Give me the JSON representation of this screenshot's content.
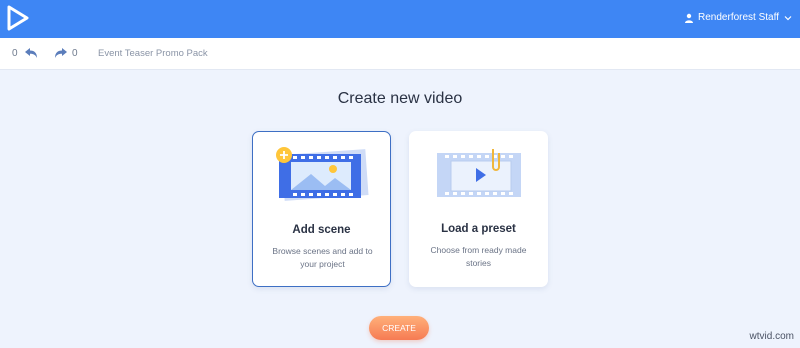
{
  "header": {
    "user_name": "Renderforest Staff"
  },
  "toolbar": {
    "undo_count": "0",
    "redo_count": "0",
    "project_name": "Event Teaser Promo Pack"
  },
  "main": {
    "heading": "Create new video",
    "cards": [
      {
        "title": "Add scene",
        "description": "Browse scenes and add to your project",
        "selected": true
      },
      {
        "title": "Load a preset",
        "description": "Choose from ready made stories",
        "selected": false
      }
    ],
    "create_label": "CREATE"
  },
  "watermark": "wtvid.com",
  "colors": {
    "topbar": "#3e86f4",
    "background": "#eef3fd",
    "selected_border": "#3e6fc4",
    "create_button": "#f67b53"
  }
}
